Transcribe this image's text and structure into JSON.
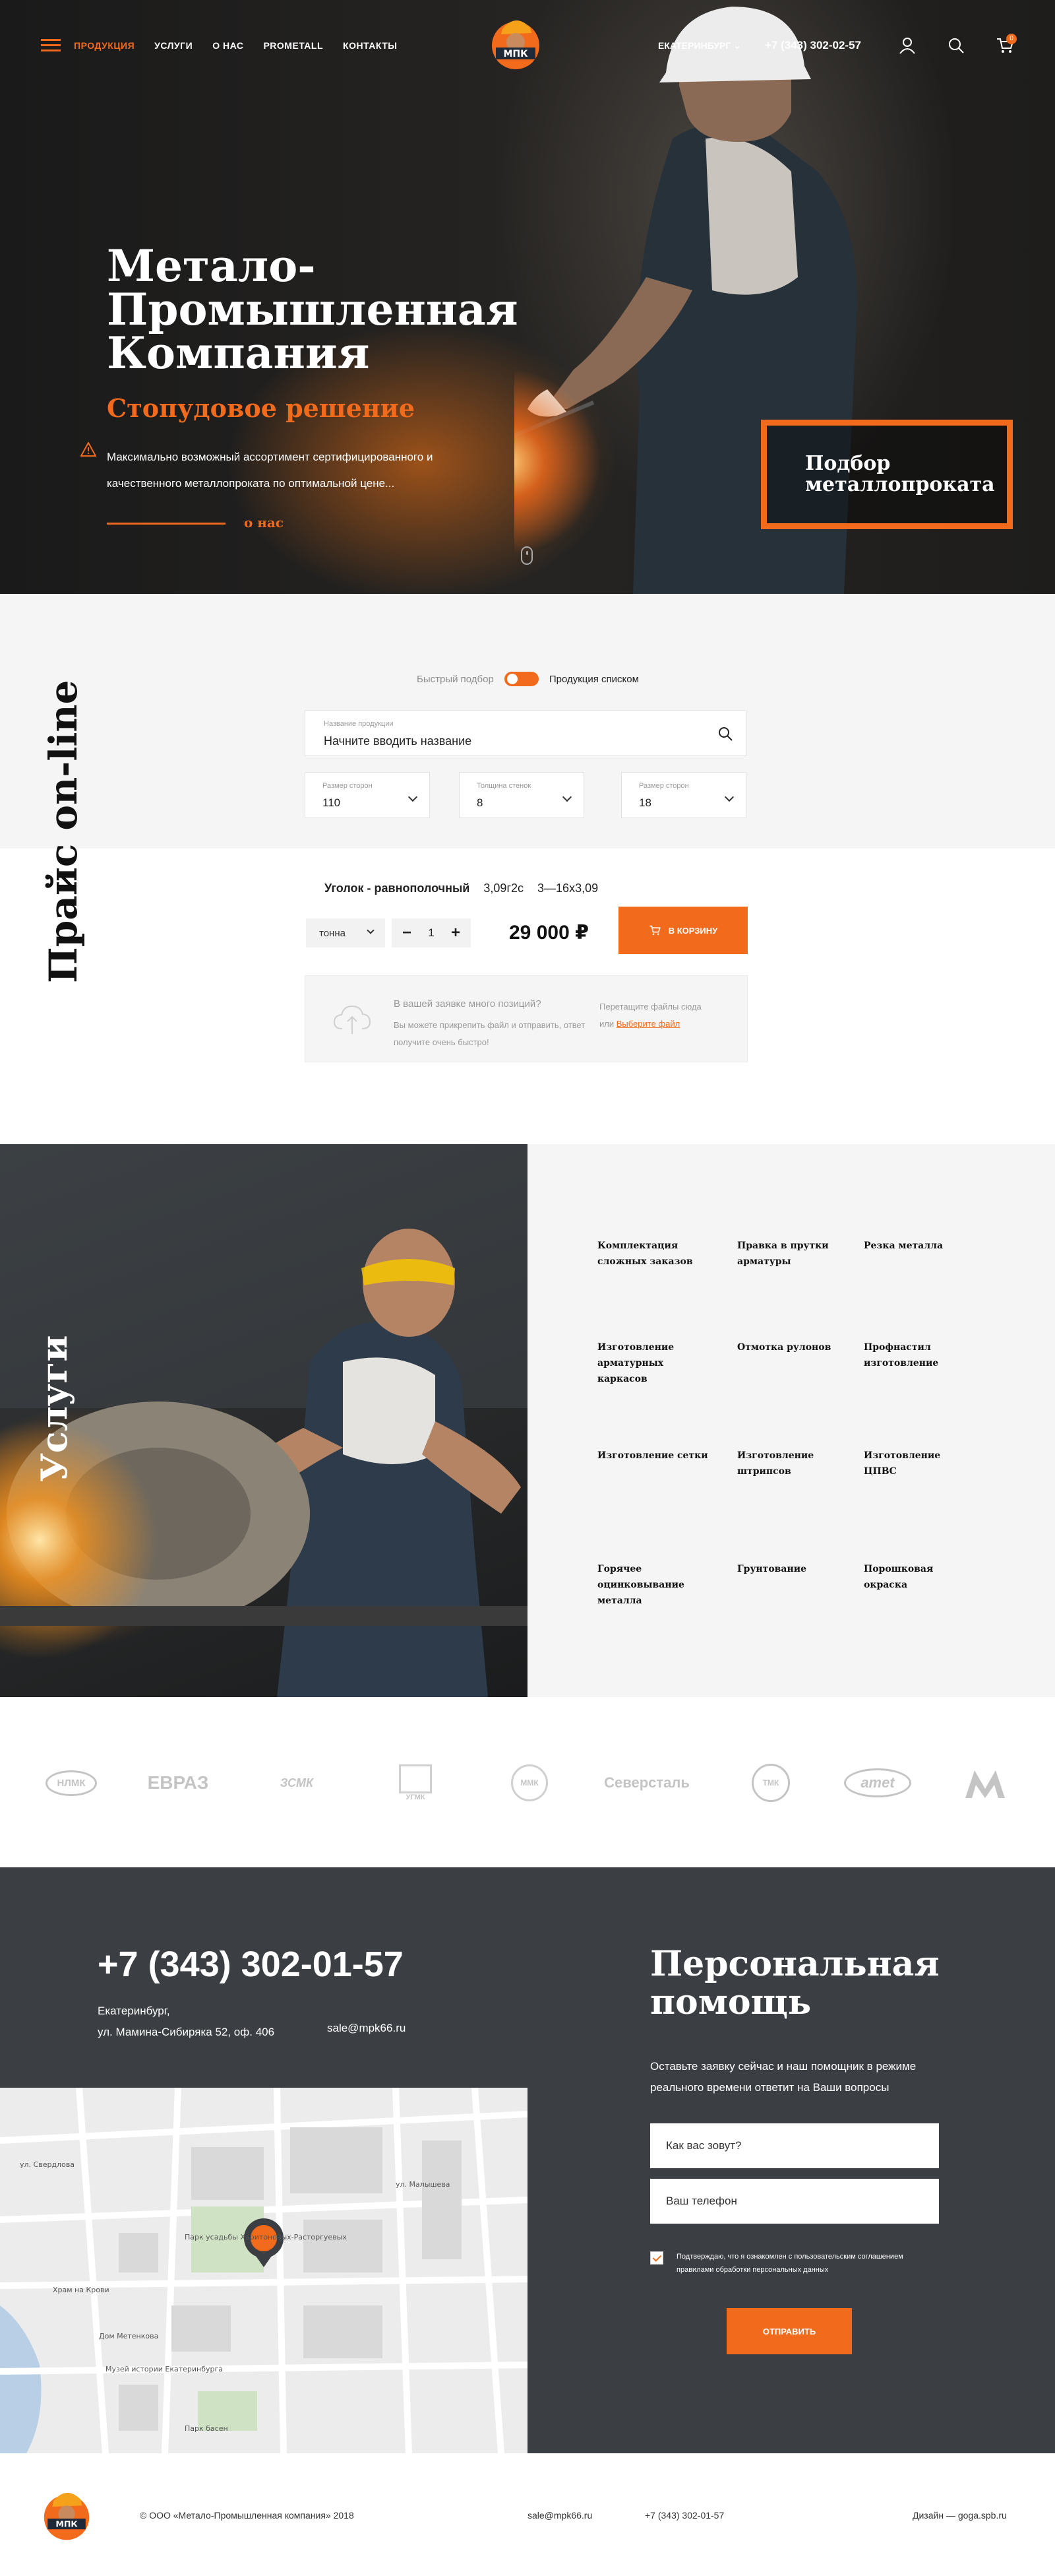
{
  "header": {
    "nav": [
      "Продукция",
      "Услуги",
      "О нас",
      "PROMETALL",
      "Контакты"
    ],
    "city": "Екатеринбург",
    "phone": "+7 (343) 302-02-57",
    "cart_count": "0",
    "logo_text": "МПК"
  },
  "hero": {
    "title_lines": [
      "Метало-",
      "Промышленная",
      "Компания"
    ],
    "subtitle": "Стопудовое решение",
    "description": "Максимально возможный ассортимент сертифицированного и качественного металлопроката по оптимальной цене...",
    "about_link": "о нас",
    "pick_button": [
      "Подбор",
      "металлопроката"
    ]
  },
  "price": {
    "section_title": "Прайс on-line",
    "switch_left": "Быстрый подбор",
    "switch_right": "Продукция списком",
    "search_caption": "Название продукции",
    "search_placeholder": "Начните вводить название",
    "selects": [
      {
        "caption": "Размер сторон",
        "value": "110"
      },
      {
        "caption": "Толщина стенок",
        "value": "8"
      },
      {
        "caption": "Размер сторон",
        "value": "18"
      }
    ],
    "product": {
      "name": "Уголок - равнополочный",
      "grade": "3,09г2с",
      "size": "3—16х3,09"
    },
    "unit": "тонна",
    "qty": "1",
    "price": "29 000 ₽",
    "cart_button": "В корзину",
    "upload": {
      "title": "В вашей заявке много позиций?",
      "text": "Вы можете прикрепить файл и отправить, ответ получите очень быстро!",
      "drop_text": "Перетащите файлы сюда",
      "or_text": "или",
      "choose_link": "Выберите файл"
    }
  },
  "services": {
    "section_title": "Услуги",
    "items": [
      "Комплектация сложных заказов",
      "Правка в прутки арматуры",
      "Резка металла",
      "Изготовление арматурных каркасов",
      "Отмотка рулонов",
      "Профнастил изготовление",
      "Изготовление сетки",
      "Изготовление штрипсов",
      "Изготовление ЦПВС",
      "Горячее оцинковывание металла",
      "Грунтование",
      "Порошковая окраска"
    ]
  },
  "partners": [
    "НЛМК",
    "ЕВРАЗ",
    "ЗСМК",
    "УГМК",
    "ММК",
    "Северсталь",
    "ТМК",
    "amet",
    "ММК"
  ],
  "contacts": {
    "phone": "+7 (343) 302-01-57",
    "city": "Екатеринбург,",
    "address": "ул. Мамина-Сибиряка 52, оф. 406",
    "email": "sale@mpk66.ru",
    "map_labels": [
      "Парк усадьбы Харитоновых-Расторгуевых",
      "Храм на Крови",
      "Дом Метенкова",
      "Музей истории Екатеринбурга",
      "Парк басен",
      "ул. Малышева",
      "ул. Свердлова"
    ],
    "help_title": [
      "Персональная",
      "помощь"
    ],
    "help_text": "Оставьте заявку сейчас и наш помощник в режиме реального времени ответит на Ваши вопросы",
    "name_placeholder": "Как вас зовут?",
    "phone_placeholder": "Ваш телефон",
    "consent": "Подтверждаю, что я ознакомлен с пользовательским соглашением правилами обработки персональных данных",
    "send_button": "Отправить"
  },
  "footer": {
    "copyright": "© ООО «Метало-Промышленная компания» 2018",
    "email": "sale@mpk66.ru",
    "phone": "+7 (343) 302-01-57",
    "design": "Дизайн — goga.spb.ru"
  },
  "colors": {
    "accent": "#f26a1b",
    "dark": "#3b3f44",
    "light_bg": "#f5f5f5"
  }
}
